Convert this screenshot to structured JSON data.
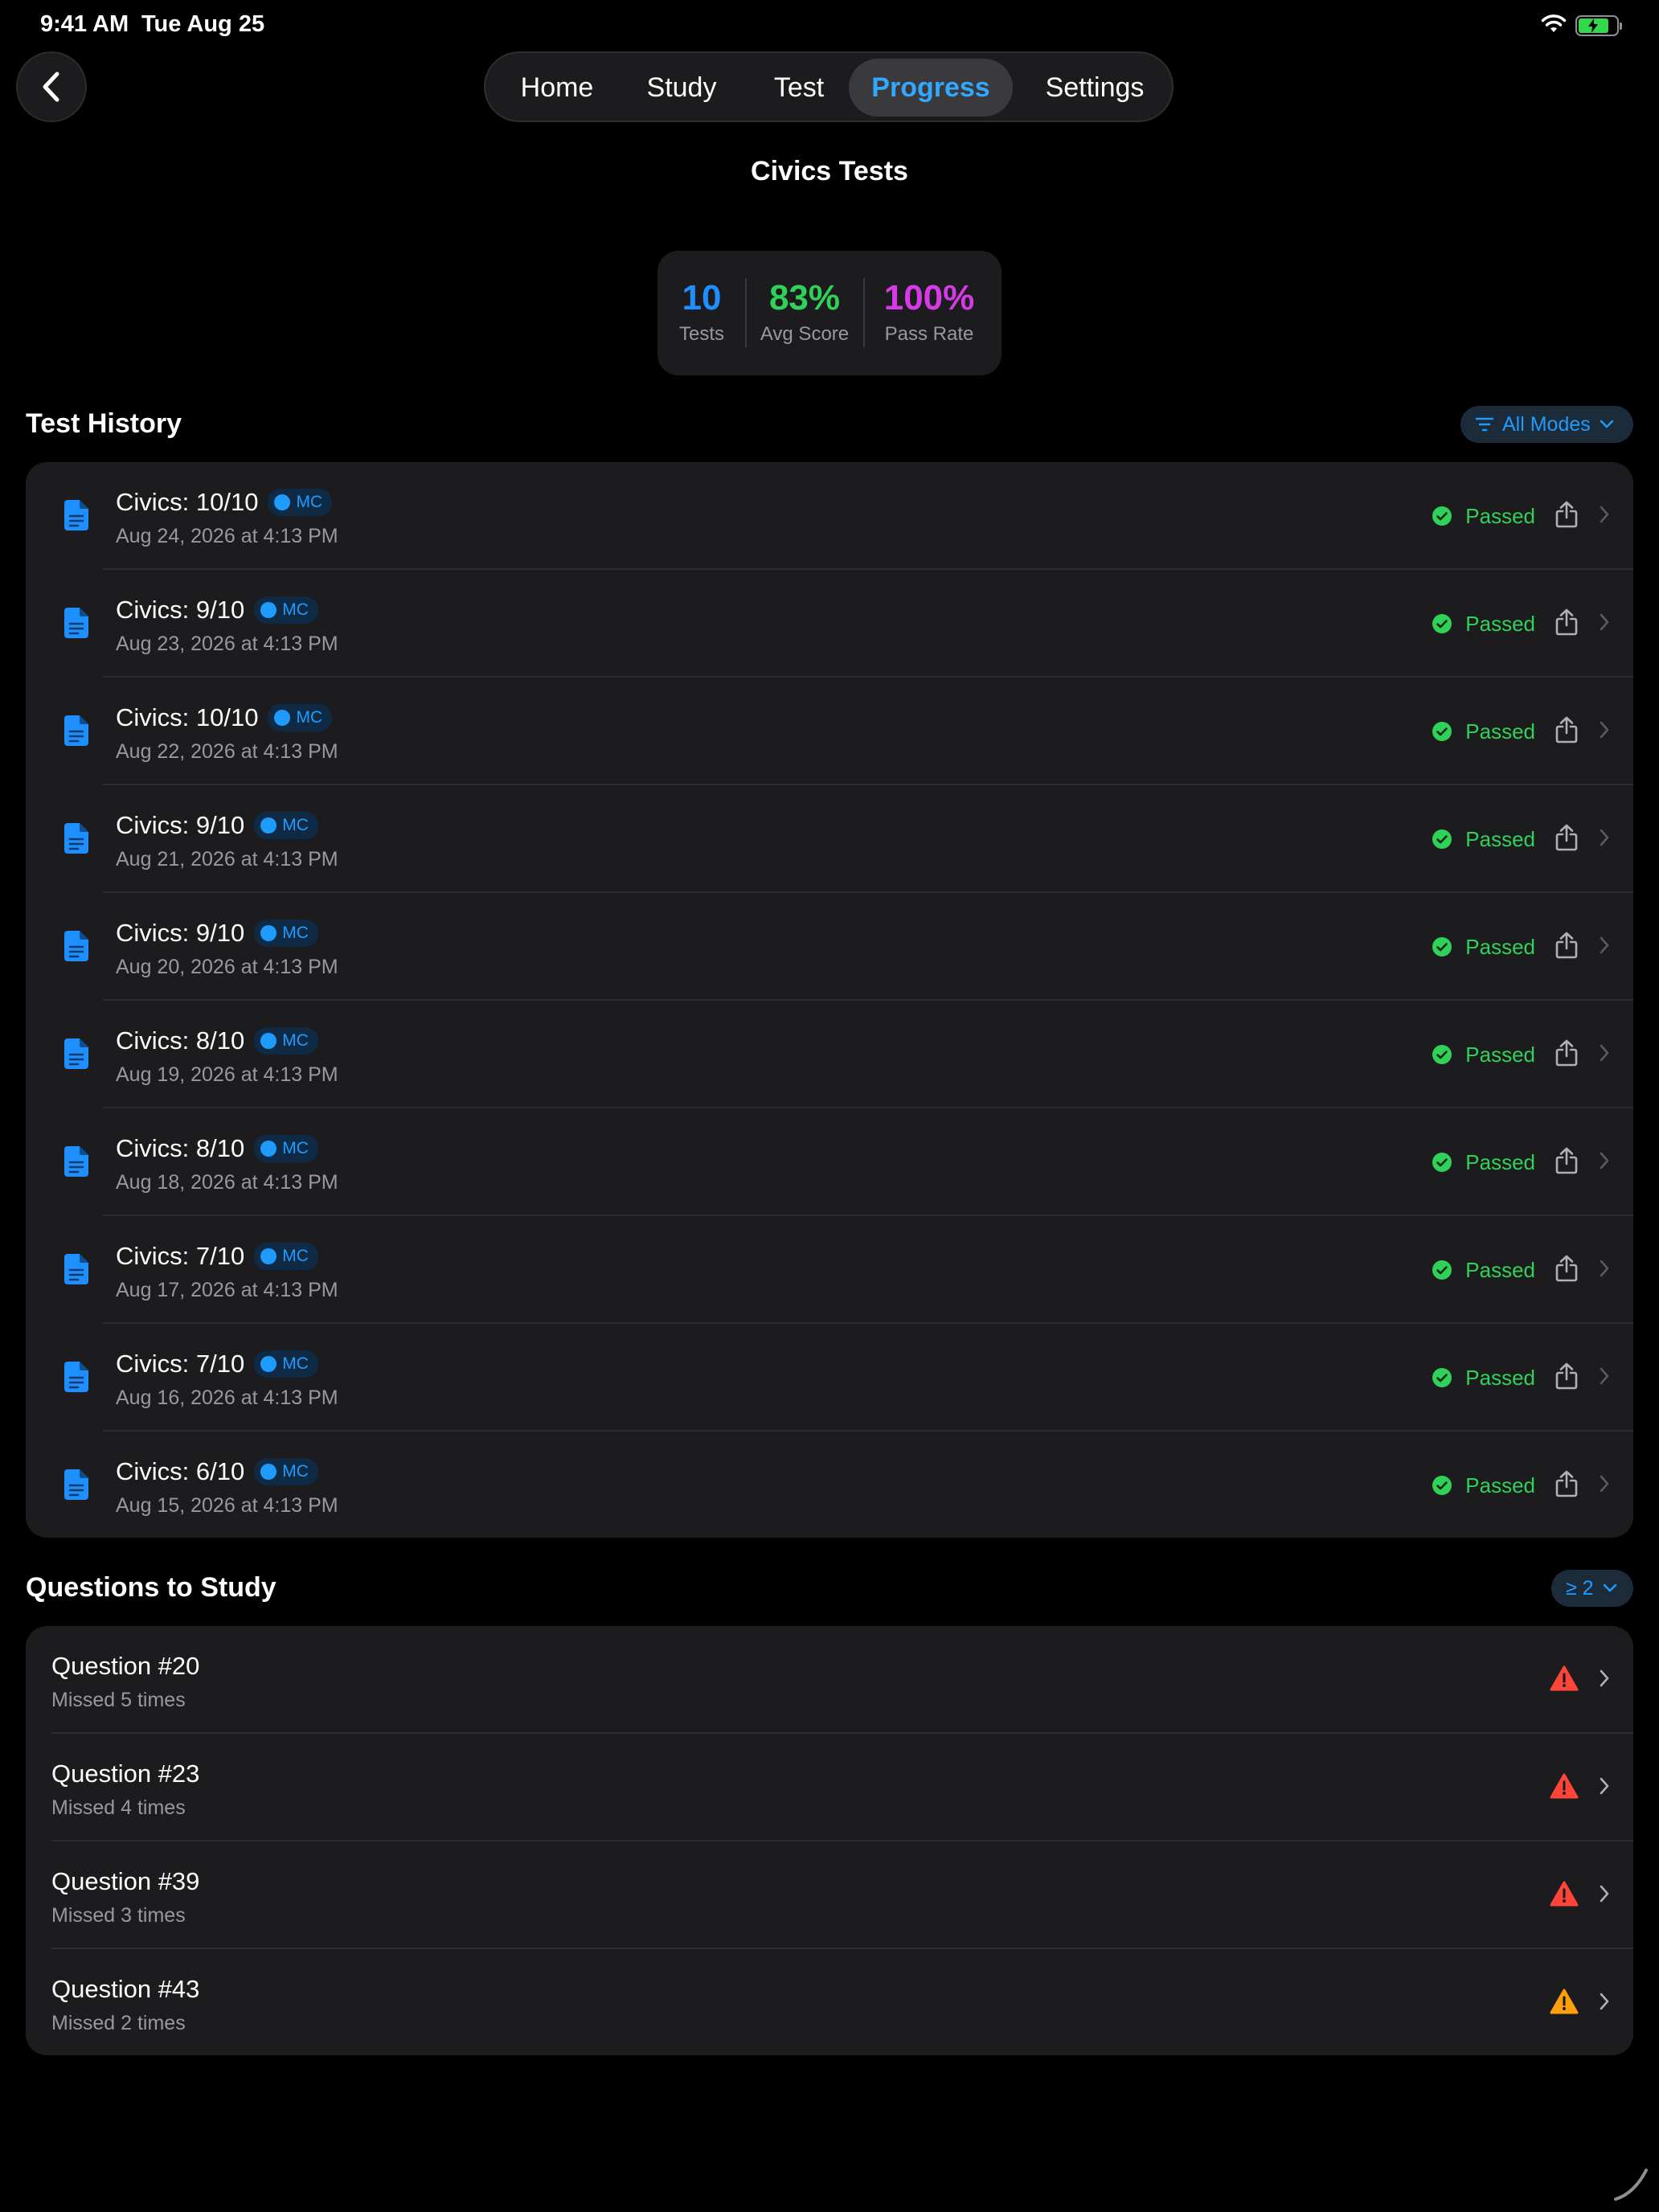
{
  "status_bar": {
    "time": "9:41 AM",
    "date": "Tue Aug 25"
  },
  "nav": {
    "tabs": [
      "Home",
      "Study",
      "Test",
      "Progress",
      "Settings"
    ],
    "active": "Progress"
  },
  "page_title": "Civics Tests",
  "stats": [
    {
      "value": "10",
      "label": "Tests",
      "color": "#1e8fff"
    },
    {
      "value": "83%",
      "label": "Avg Score",
      "color": "#30d158"
    },
    {
      "value": "100%",
      "label": "Pass Rate",
      "color": "#d63ae6"
    }
  ],
  "test_history": {
    "title": "Test History",
    "filter_label": "All Modes",
    "items": [
      {
        "title": "Civics: 10/10",
        "badge": "MC",
        "date": "Aug 24, 2026 at 4:13 PM",
        "status": "Passed"
      },
      {
        "title": "Civics: 9/10",
        "badge": "MC",
        "date": "Aug 23, 2026 at 4:13 PM",
        "status": "Passed"
      },
      {
        "title": "Civics: 10/10",
        "badge": "MC",
        "date": "Aug 22, 2026 at 4:13 PM",
        "status": "Passed"
      },
      {
        "title": "Civics: 9/10",
        "badge": "MC",
        "date": "Aug 21, 2026 at 4:13 PM",
        "status": "Passed"
      },
      {
        "title": "Civics: 9/10",
        "badge": "MC",
        "date": "Aug 20, 2026 at 4:13 PM",
        "status": "Passed"
      },
      {
        "title": "Civics: 8/10",
        "badge": "MC",
        "date": "Aug 19, 2026 at 4:13 PM",
        "status": "Passed"
      },
      {
        "title": "Civics: 8/10",
        "badge": "MC",
        "date": "Aug 18, 2026 at 4:13 PM",
        "status": "Passed"
      },
      {
        "title": "Civics: 7/10",
        "badge": "MC",
        "date": "Aug 17, 2026 at 4:13 PM",
        "status": "Passed"
      },
      {
        "title": "Civics: 7/10",
        "badge": "MC",
        "date": "Aug 16, 2026 at 4:13 PM",
        "status": "Passed"
      },
      {
        "title": "Civics: 6/10",
        "badge": "MC",
        "date": "Aug 15, 2026 at 4:13 PM",
        "status": "Passed"
      }
    ]
  },
  "questions_to_study": {
    "title": "Questions to Study",
    "filter_label": "≥ 2",
    "items": [
      {
        "title": "Question #20",
        "subtitle": "Missed 5 times",
        "warning_color": "#ff453a"
      },
      {
        "title": "Question #23",
        "subtitle": "Missed 4 times",
        "warning_color": "#ff453a"
      },
      {
        "title": "Question #39",
        "subtitle": "Missed 3 times",
        "warning_color": "#ff453a"
      },
      {
        "title": "Question #43",
        "subtitle": "Missed 2 times",
        "warning_color": "#ff9f0a"
      }
    ]
  },
  "colors": {
    "accent": "#1e9bff",
    "passed": "#30d158",
    "background": "#000000",
    "card": "#1c1c1e"
  },
  "icons": [
    "back-chevron",
    "document",
    "checkmark-circle",
    "share",
    "chevron-right",
    "warning-triangle",
    "filter",
    "chevron-down",
    "wifi",
    "battery-charging"
  ]
}
